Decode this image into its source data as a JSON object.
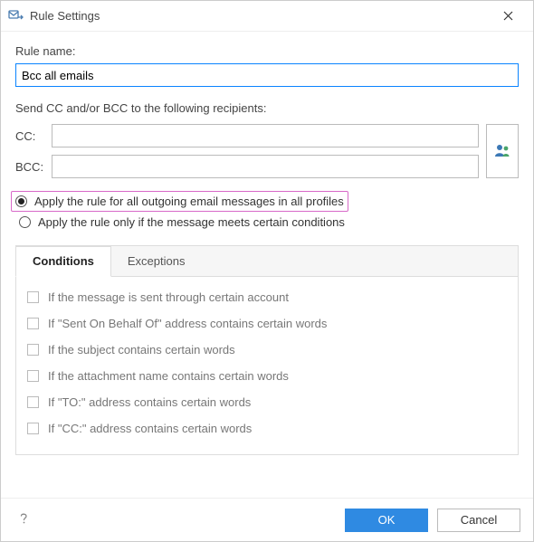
{
  "window": {
    "title": "Rule Settings"
  },
  "ruleName": {
    "label": "Rule name:",
    "value": "Bcc all emails"
  },
  "recipientsSection": {
    "label": "Send CC and/or BCC to the following recipients:",
    "ccLabel": "CC:",
    "bccLabel": "BCC:",
    "ccValue": "",
    "bccValue": ""
  },
  "scope": {
    "allLabel": "Apply the rule for all outgoing email messages in all profiles",
    "conditionalLabel": "Apply the rule only if the message meets certain conditions",
    "selected": "all"
  },
  "tabs": {
    "conditions": "Conditions",
    "exceptions": "Exceptions",
    "active": "conditions"
  },
  "conditions": [
    {
      "label": "If the message is sent through certain account",
      "checked": false
    },
    {
      "label": "If \"Sent On Behalf Of\" address contains certain words",
      "checked": false
    },
    {
      "label": "If the subject contains certain words",
      "checked": false
    },
    {
      "label": "If the attachment name contains certain words",
      "checked": false
    },
    {
      "label": "If \"TO:\" address contains certain words",
      "checked": false
    },
    {
      "label": "If \"CC:\" address contains certain words",
      "checked": false
    }
  ],
  "buttons": {
    "ok": "OK",
    "cancel": "Cancel"
  }
}
